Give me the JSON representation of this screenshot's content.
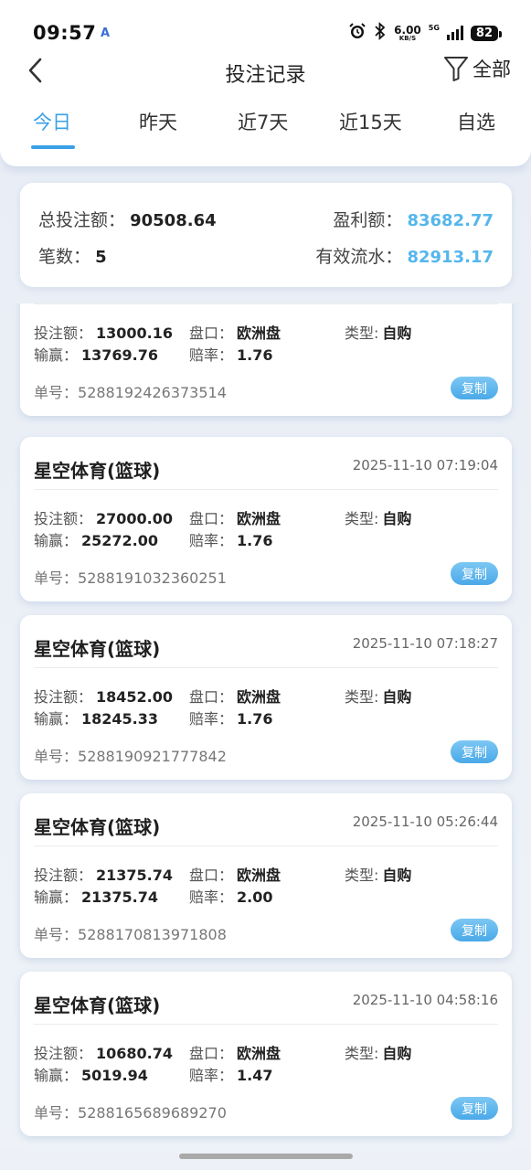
{
  "status_bar": {
    "time": "09:57",
    "time_badge": "A",
    "net_speed_value": "6.00",
    "net_speed_unit": "KB/S",
    "network": "5G",
    "battery": "82",
    "icons": [
      "alarm-icon",
      "bluetooth-icon",
      "signal-icon",
      "battery-icon"
    ]
  },
  "nav": {
    "title": "投注记录",
    "filter_label": "全部"
  },
  "tabs": [
    {
      "label": "今日",
      "active": true
    },
    {
      "label": "昨天",
      "active": false
    },
    {
      "label": "近7天",
      "active": false
    },
    {
      "label": "近15天",
      "active": false
    },
    {
      "label": "自选",
      "active": false
    }
  ],
  "summary": {
    "total_bet_label": "总投注额：",
    "total_bet_value": "90508.64",
    "profit_label": "盈利额：",
    "profit_value": "83682.77",
    "count_label": "笔数：",
    "count_value": "5",
    "turnover_label": "有效流水：",
    "turnover_value": "82913.17"
  },
  "labels": {
    "bet": "投注额：",
    "pan": "盘口：",
    "type": "类型:",
    "win": "输赢：",
    "odds": "赔率：",
    "order": "单号：",
    "copy": "复制"
  },
  "orders": [
    {
      "title": "",
      "time": "",
      "bet": "13000.16",
      "pan": "欧洲盘",
      "type": "自购",
      "win": "13769.76",
      "odds": "1.76",
      "order_no": "5288192426373514"
    },
    {
      "title": "星空体育(篮球)",
      "time": "2025-11-10 07:19:04",
      "bet": "27000.00",
      "pan": "欧洲盘",
      "type": "自购",
      "win": "25272.00",
      "odds": "1.76",
      "order_no": "5288191032360251"
    },
    {
      "title": "星空体育(篮球)",
      "time": "2025-11-10 07:18:27",
      "bet": "18452.00",
      "pan": "欧洲盘",
      "type": "自购",
      "win": "18245.33",
      "odds": "1.76",
      "order_no": "5288190921777842"
    },
    {
      "title": "星空体育(篮球)",
      "time": "2025-11-10 05:26:44",
      "bet": "21375.74",
      "pan": "欧洲盘",
      "type": "自购",
      "win": "21375.74",
      "odds": "2.00",
      "order_no": "5288170813971808"
    },
    {
      "title": "星空体育(篮球)",
      "time": "2025-11-10 04:58:16",
      "bet": "10680.74",
      "pan": "欧洲盘",
      "type": "自购",
      "win": "5019.94",
      "odds": "1.47",
      "order_no": "5288165689689270"
    }
  ],
  "colors": {
    "accent": "#3aa0e6",
    "highlight_value": "#55b6ec",
    "background": "#edf1f7"
  }
}
